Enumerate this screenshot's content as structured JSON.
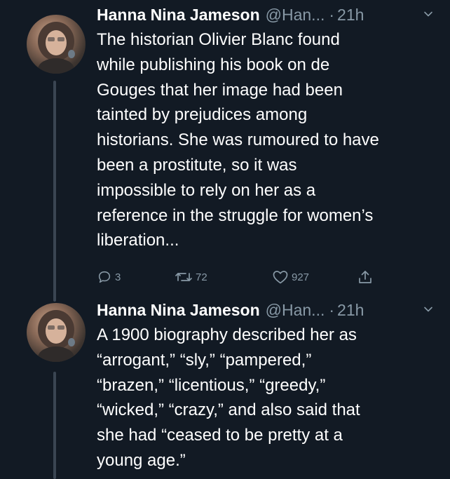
{
  "tweets": [
    {
      "author_name": "Hanna Nina Jameson",
      "handle": "@Han...",
      "separator": "·",
      "time": "21h",
      "body_lines": [
        "The historian Olivier Blanc found",
        "while publishing his book on de",
        "Gouges that her image had been",
        "tainted by prejudices among",
        "historians. She was rumoured to have",
        "been a prostitute, so it was",
        "impossible to rely on her as a",
        "reference in the struggle for women’s",
        "liberation..."
      ],
      "actions": {
        "replies": "3",
        "retweets": "72",
        "likes": "927"
      }
    },
    {
      "author_name": "Hanna Nina Jameson",
      "handle": "@Han...",
      "separator": "·",
      "time": "21h",
      "body_lines": [
        "A 1900 biography described her as",
        "“arrogant,” “sly,” “pampered,”",
        "“brazen,” “licentious,” “greedy,”",
        "“wicked,” “crazy,” and also said that",
        "she had “ceased to be pretty at a",
        "young age.”"
      ]
    }
  ],
  "icons": {
    "reply": "reply-icon",
    "retweet": "retweet-icon",
    "like": "heart-icon",
    "share": "share-icon",
    "menu": "chevron-down-icon"
  },
  "colors": {
    "background": "#121a24",
    "text": "#ffffff",
    "secondary": "#8899a6"
  }
}
